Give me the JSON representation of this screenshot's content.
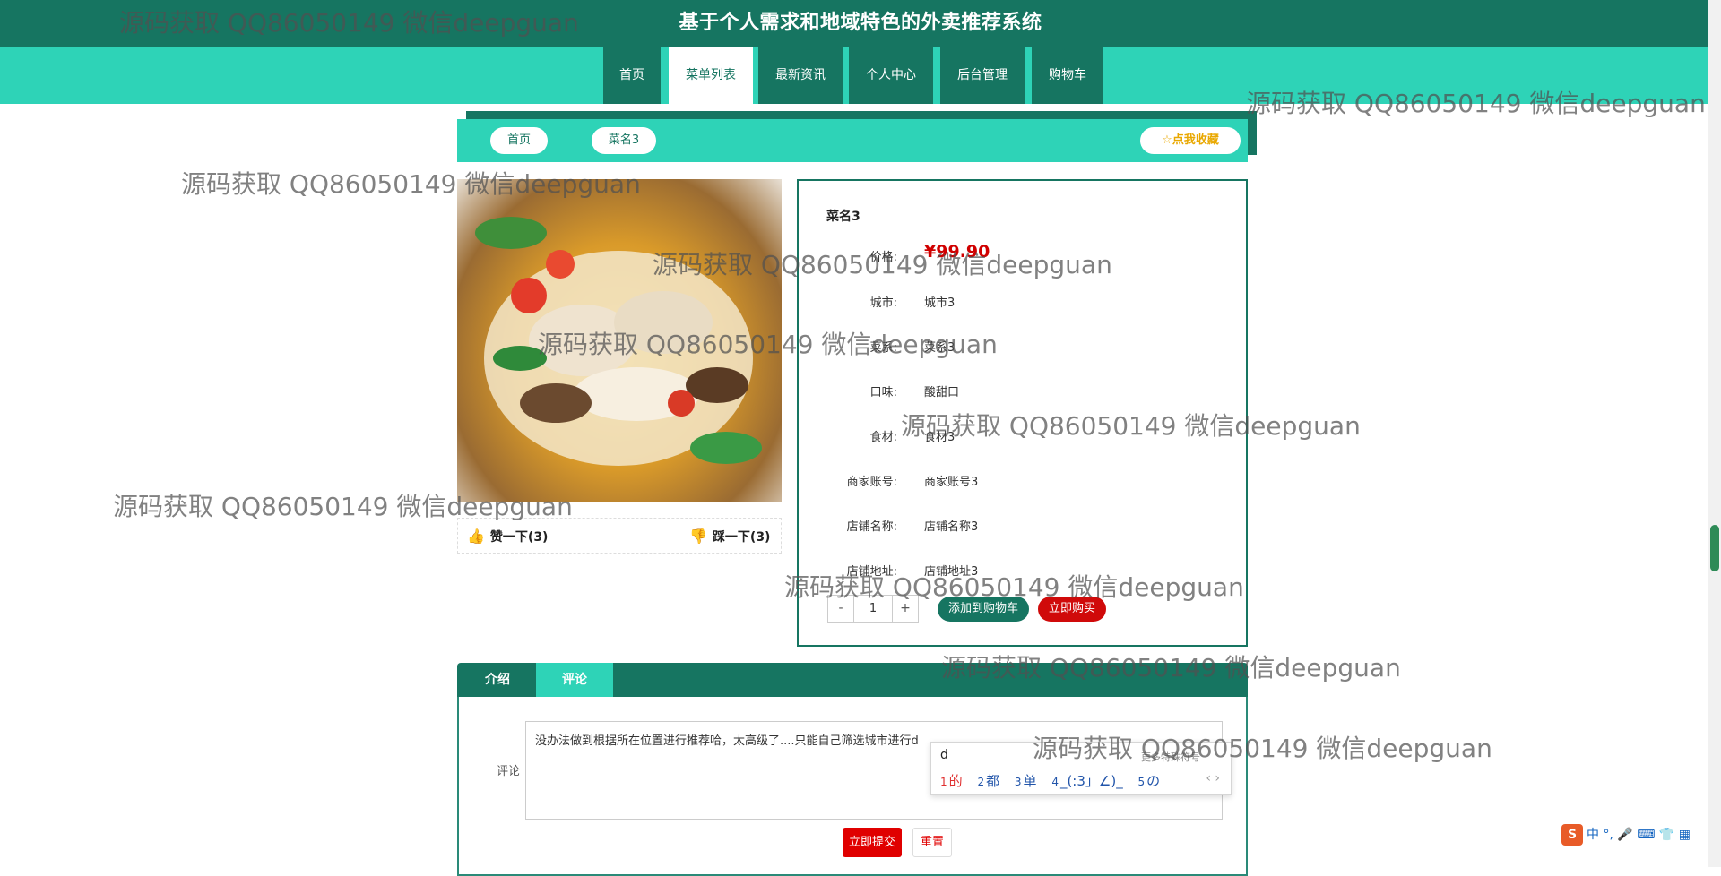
{
  "site_title": "基于个人需求和地域特色的外卖推荐系统",
  "nav": {
    "items": [
      "首页",
      "菜单列表",
      "最新资讯",
      "个人中心",
      "后台管理",
      "购物车"
    ],
    "active_index": 1
  },
  "breadcrumb": {
    "home": "首页",
    "current": "菜名3"
  },
  "favorite_button": "☆点我收藏",
  "votes": {
    "like": "赞一下(3)",
    "dislike": "踩一下(3)"
  },
  "dish": {
    "name": "菜名3",
    "price_label": "价格:",
    "price_value": "¥99.90",
    "fields": [
      {
        "label": "城市:",
        "value": "城市3"
      },
      {
        "label": "菜系:",
        "value": "菜系3"
      },
      {
        "label": "口味:",
        "value": "酸甜口"
      },
      {
        "label": "食材:",
        "value": "食材3"
      },
      {
        "label": "商家账号:",
        "value": "商家账号3"
      },
      {
        "label": "店铺名称:",
        "value": "店铺名称3"
      },
      {
        "label": "店铺地址:",
        "value": "店铺地址3"
      }
    ]
  },
  "quantity": {
    "minus": "-",
    "value": "1",
    "plus": "+"
  },
  "buttons": {
    "add_to_cart": "添加到购物车",
    "buy_now": "立即购买",
    "submit": "立即提交",
    "reset": "重置"
  },
  "tabs": [
    "介绍",
    "评论"
  ],
  "active_tab": 1,
  "comment": {
    "label": "评论",
    "text": "没办法做到根据所在位置进行推荐哈，太高级了....只能自己筛选城市进行d"
  },
  "ime": {
    "input": "d",
    "more": "更多特殊符号",
    "candidates": [
      {
        "n": "1",
        "t": "的"
      },
      {
        "n": "2",
        "t": "都"
      },
      {
        "n": "3",
        "t": "单"
      },
      {
        "n": "4",
        "t": "_(:3」∠)_"
      },
      {
        "n": "5",
        "t": "の"
      }
    ],
    "arrows": "‹ ›"
  },
  "watermark": "源码获取 QQ86050149 微信deepguan",
  "tray": {
    "icons": "中 °, 🎤 ⌨ 👕 ▦"
  },
  "colors": {
    "primary": "#167561",
    "accent": "#2ed3b7",
    "danger": "#d00a0a"
  }
}
